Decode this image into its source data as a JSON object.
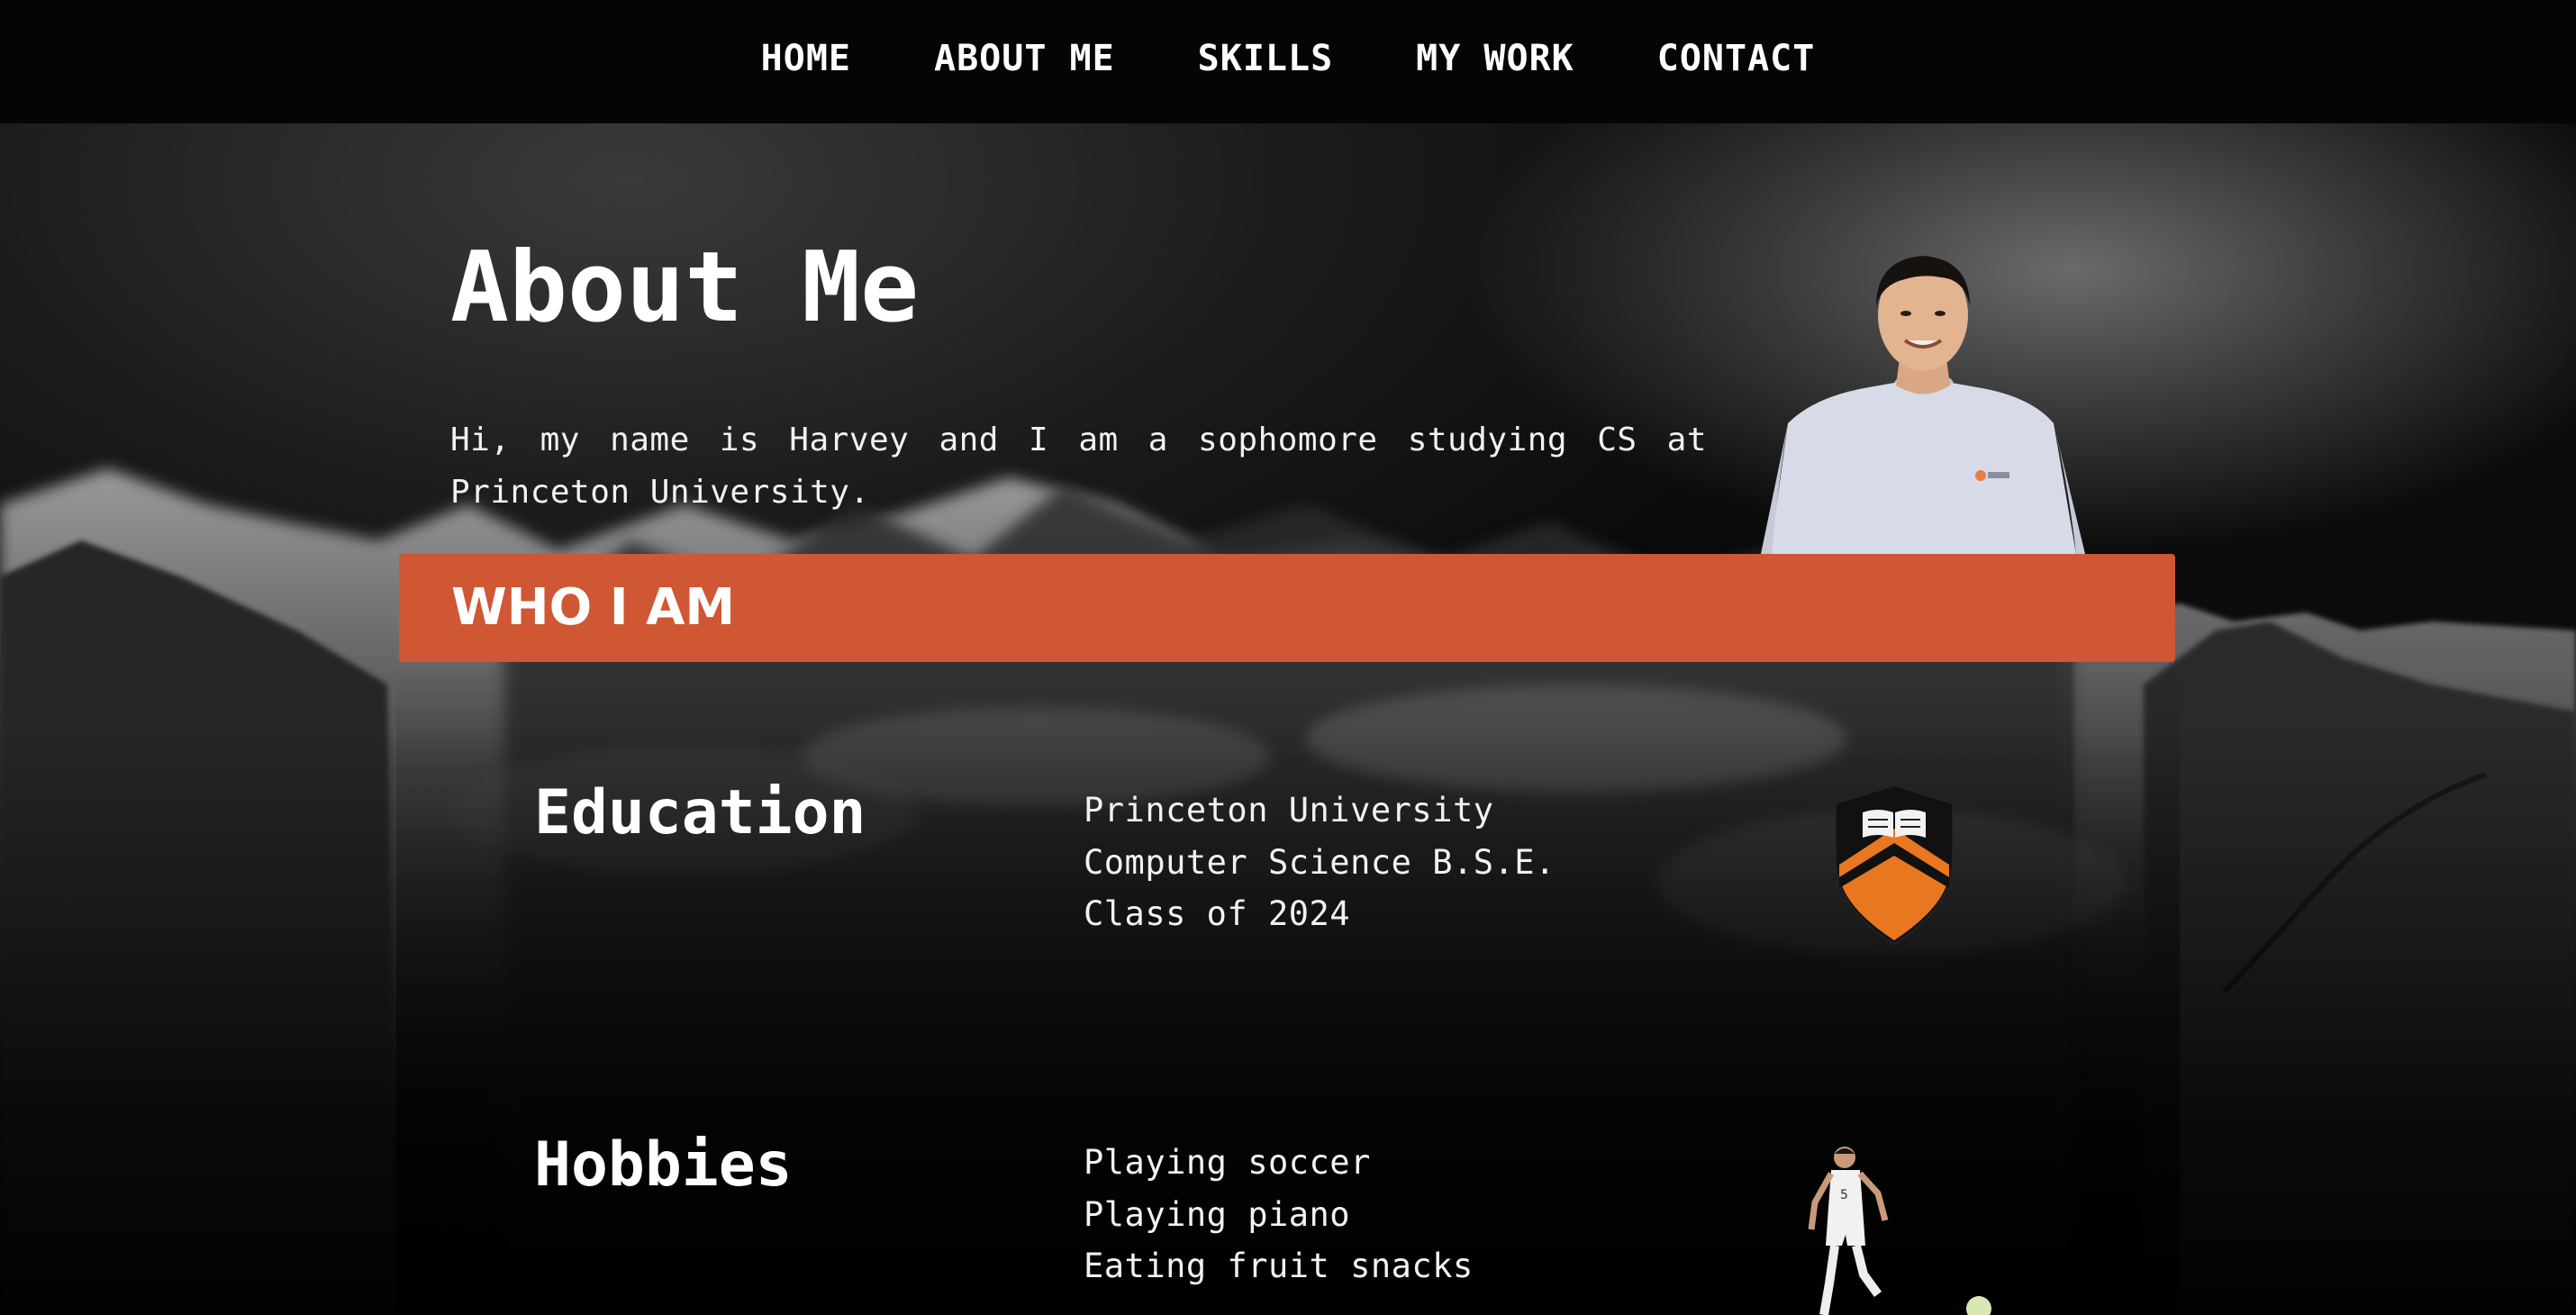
{
  "nav": {
    "items": [
      {
        "label": "HOME"
      },
      {
        "label": "ABOUT ME"
      },
      {
        "label": "SKILLS"
      },
      {
        "label": "MY WORK"
      },
      {
        "label": "CONTACT"
      }
    ]
  },
  "about": {
    "title": "About Me",
    "intro": "Hi, my name is Harvey and I am a sophomore studying CS at Princeton University."
  },
  "banner": {
    "title": "WHO I AM",
    "color": "#cf5734"
  },
  "education": {
    "heading": "Education",
    "lines": [
      "Princeton University",
      "Computer Science B.S.E.",
      "Class of 2024"
    ],
    "icon": "princeton-shield-icon"
  },
  "hobbies": {
    "heading": "Hobbies",
    "lines": [
      "Playing soccer",
      "Playing piano",
      "Eating fruit snacks"
    ],
    "icon": "soccer-player-icon"
  },
  "colors": {
    "accent": "#cf5734",
    "shield_orange": "#e8771f",
    "background": "#0b0b0b"
  }
}
